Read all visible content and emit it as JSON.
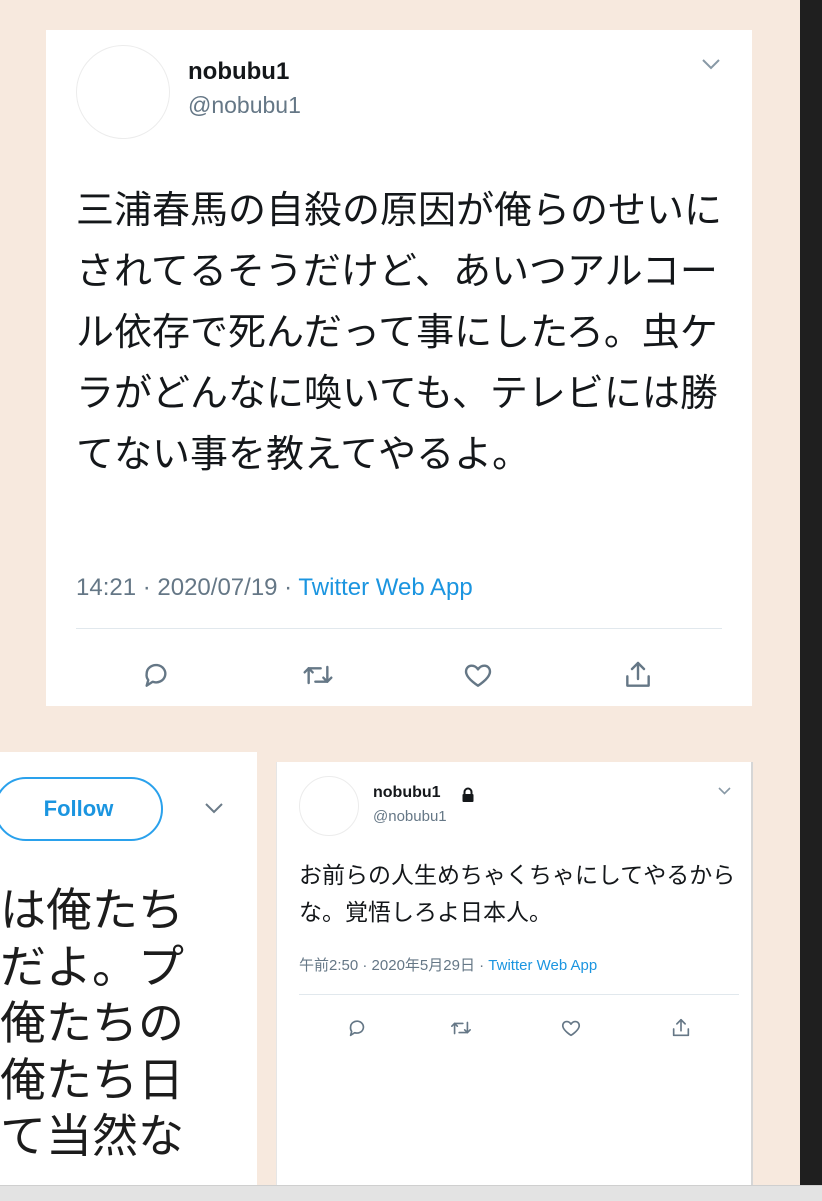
{
  "main_tweet": {
    "display_name": "nobubu1",
    "handle": "@nobubu1",
    "text": "三浦春馬の自殺の原因が俺らのせいにされてるそうだけど、あいつアルコール依存で死んだって事にしたろ。虫ケラがどんなに喚いても、テレビには勝てない事を教えてやるよ。",
    "time": "14:21",
    "separator": " · ",
    "date": "2020/07/19",
    "source": "Twitter Web App",
    "menu_icon": "chevron-down-icon",
    "actions": [
      "reply-icon",
      "retweet-icon",
      "like-icon",
      "share-icon"
    ]
  },
  "left_card": {
    "follow_label": "Follow",
    "menu_icon": "chevron-down-icon",
    "lines": [
      "は俺たち",
      "だよ。プ",
      "俺たちの",
      "俺たち日",
      "て当然な"
    ]
  },
  "small_tweet": {
    "display_name": "nobubu1",
    "handle": "@nobubu1",
    "protected_icon": "lock-icon",
    "text": "お前らの人生めちゃくちゃにしてやるからな。覚悟しろよ日本人。",
    "time": "午前2:50",
    "separator": " · ",
    "date": "2020年5月29日",
    "source": "Twitter Web App",
    "menu_icon": "chevron-down-icon",
    "actions": [
      "reply-icon",
      "retweet-icon",
      "like-icon",
      "share-icon"
    ]
  },
  "colors": {
    "page_background": "#f7e9de",
    "link": "#1b95e0",
    "secondary_text": "#657786"
  }
}
